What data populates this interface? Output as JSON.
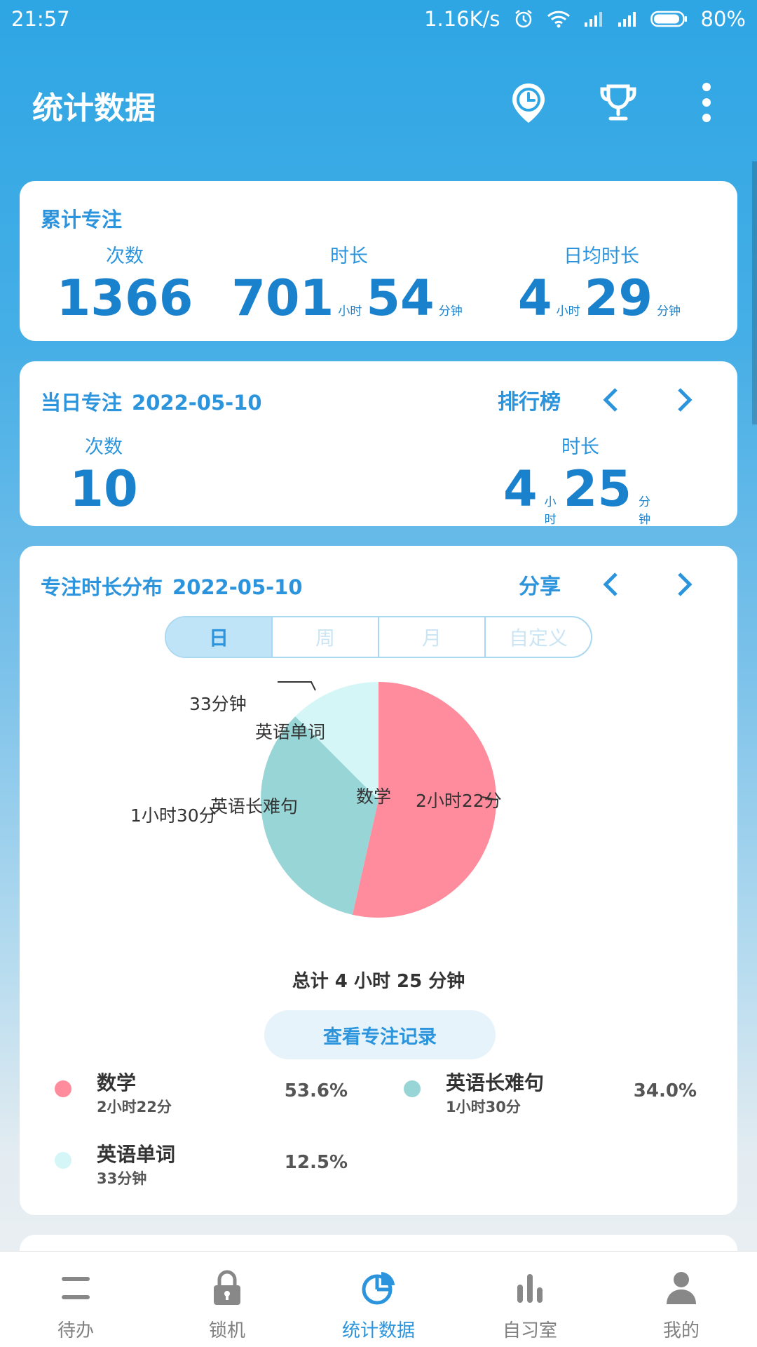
{
  "status_bar": {
    "time": "21:57",
    "net_speed": "1.16K/s",
    "battery": "80%"
  },
  "app_bar": {
    "title": "统计数据"
  },
  "total_card": {
    "title": "累计专注",
    "count": {
      "label": "次数",
      "value": "1366"
    },
    "duration": {
      "label": "时长",
      "hours": "701",
      "hours_unit": "小时",
      "minutes": "54",
      "minutes_unit": "分钟"
    },
    "daily_avg": {
      "label": "日均时长",
      "hours": "4",
      "hours_unit": "小时",
      "minutes": "29",
      "minutes_unit": "分钟"
    }
  },
  "day_card": {
    "title": "当日专注",
    "date": "2022-05-10",
    "ranking_label": "排行榜",
    "count": {
      "label": "次数",
      "value": "10"
    },
    "duration": {
      "label": "时长",
      "hours": "4",
      "hours_unit": "小时",
      "minutes": "25",
      "minutes_unit": "分钟"
    }
  },
  "dist_card": {
    "title": "专注时长分布",
    "date": "2022-05-10",
    "share_label": "分享",
    "tabs": [
      {
        "label": "日",
        "active": true
      },
      {
        "label": "周",
        "active": false
      },
      {
        "label": "月",
        "active": false
      },
      {
        "label": "自定义",
        "active": false
      }
    ],
    "total_text": "总计 4 小时 25 分钟",
    "record_button": "查看专注记录"
  },
  "chart_data": {
    "type": "pie",
    "slices": [
      {
        "name": "数学",
        "duration": "2小时22分",
        "legend_duration": "2小时22分",
        "percent": 53.6,
        "percent_label": "53.6%",
        "color": "#ff8c9c"
      },
      {
        "name": "英语长难句",
        "duration": "1小时30分",
        "legend_duration": "1小时30分",
        "percent": 34.0,
        "percent_label": "34.0%",
        "color": "#98d5d6"
      },
      {
        "name": "英语单词",
        "duration": "33分钟",
        "legend_duration": "33分钟",
        "percent": 12.5,
        "percent_label": "12.5%",
        "color": "#d4f6f7"
      }
    ]
  },
  "bottom_nav": [
    {
      "label": "待办",
      "icon": "list-icon",
      "active": false
    },
    {
      "label": "锁机",
      "icon": "lock-icon",
      "active": false
    },
    {
      "label": "统计数据",
      "icon": "pie-chart-icon",
      "active": true
    },
    {
      "label": "自习室",
      "icon": "bar-chart-icon",
      "active": false
    },
    {
      "label": "我的",
      "icon": "person-icon",
      "active": false
    }
  ]
}
